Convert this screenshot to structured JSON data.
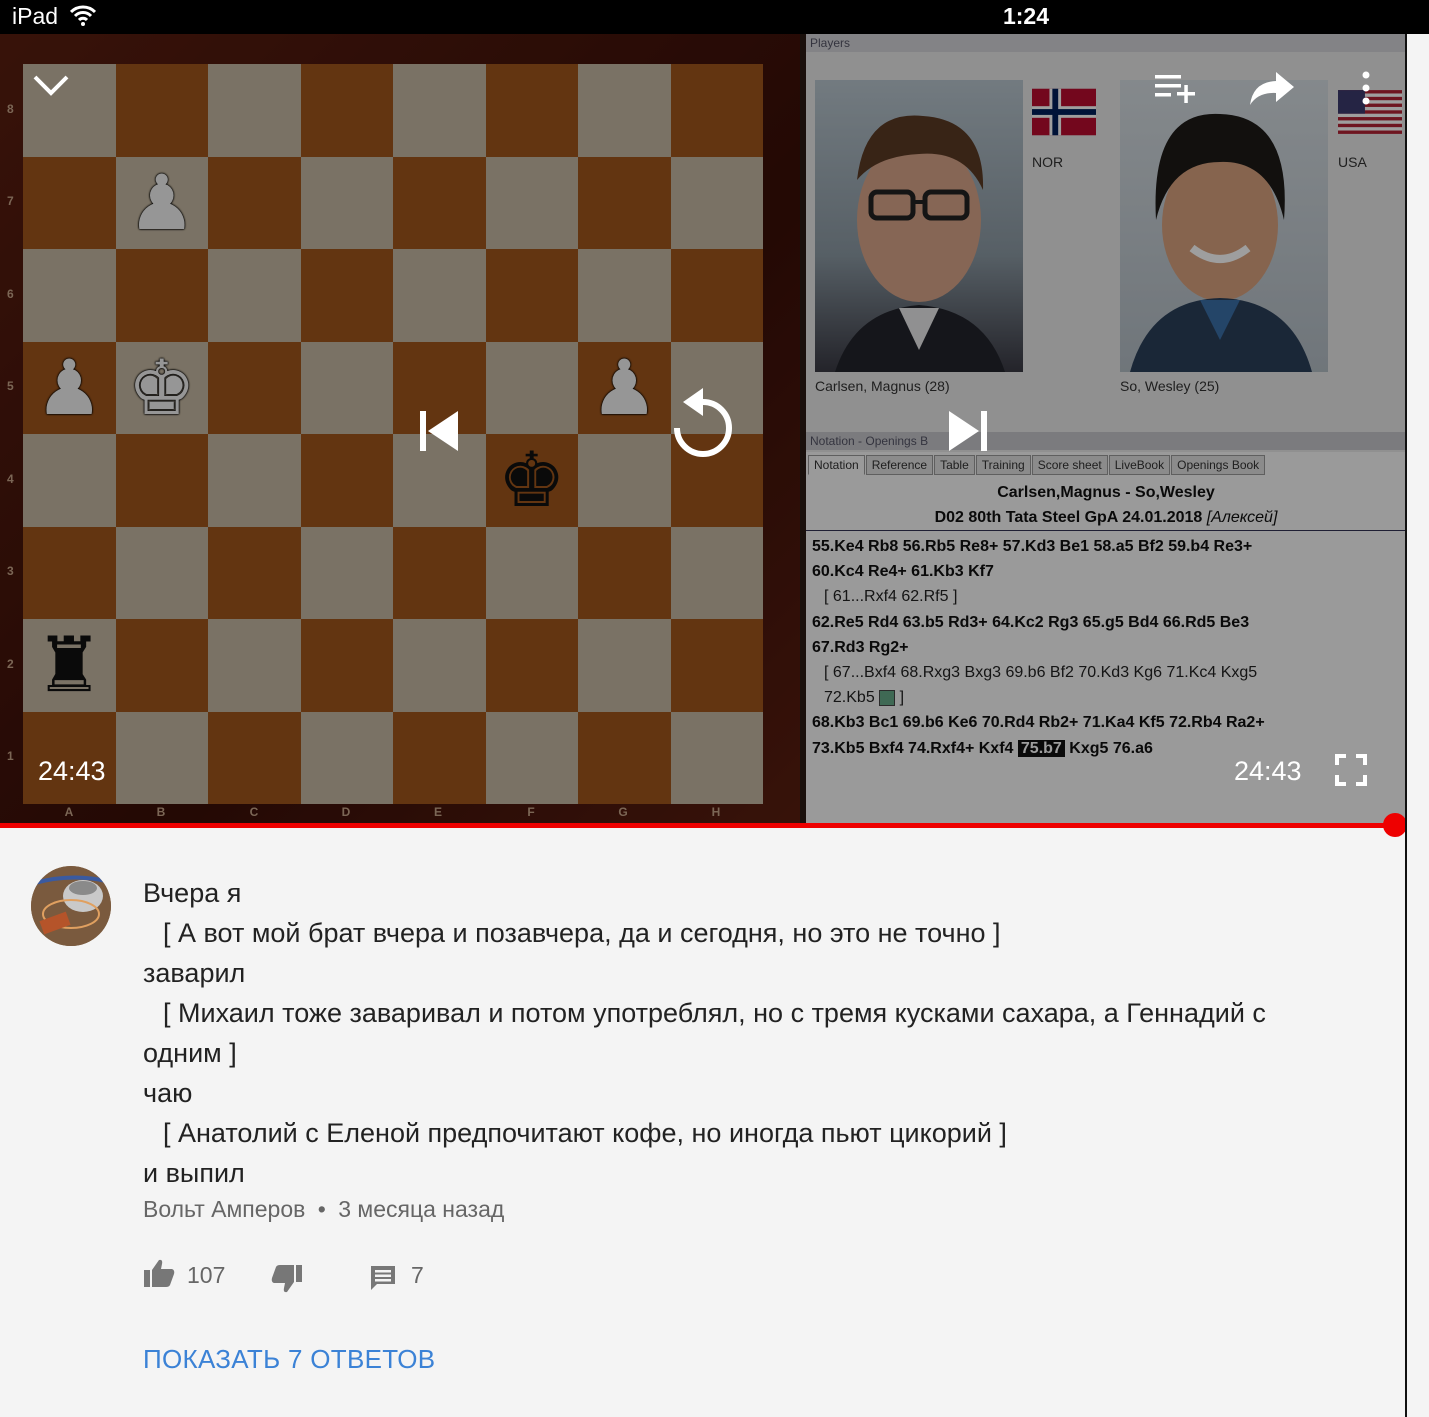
{
  "status_bar": {
    "device": "iPad",
    "time": "1:24"
  },
  "board": {
    "ranks": [
      "8",
      "7",
      "6",
      "5",
      "4",
      "3",
      "2",
      "1"
    ],
    "files": [
      "A",
      "B",
      "C",
      "D",
      "E",
      "F",
      "G",
      "H"
    ]
  },
  "players_panel": {
    "title": "Players",
    "white": {
      "name": "Carlsen, Magnus  (28)",
      "country": "NOR"
    },
    "black": {
      "name": "So, Wesley  (25)",
      "country": "USA"
    }
  },
  "notation_panel": {
    "title": "Notation - Openings B",
    "tabs": [
      "Notation",
      "Reference",
      "Table",
      "Training",
      "Score sheet",
      "LiveBook",
      "Openings Book"
    ],
    "game_players": "Carlsen,Magnus - So,Wesley",
    "game_info": "D02 80th Tata Steel GpA 24.01.2018",
    "game_annotator": "[Алексей]",
    "lines": [
      "55.Ke4  Rb8  56.Rb5  Re8+  57.Kd3  Be1  58.a5  Bf2  59.b4  Re3+",
      "60.Kc4  Re4+  61.Kb3  Kf7",
      "[ 61...Rxf4  62.Rf5 ]",
      "62.Re5  Rd4  63.b5  Rd3+  64.Kc2  Rg3  65.g5  Bd4  66.Rd5  Be3",
      "67.Rd3  Rg2+",
      "[ 67...Bxf4  68.Rxg3  Bxg3  69.b6  Bf2  70.Kd3  Kg6  71.Kc4  Kxg5",
      "72.Kb5",
      "68.Kb3  Bc1  69.b6  Ke6  70.Rd4  Rb2+  71.Ka4  Kf5  72.Rb4  Ra2+",
      "73.Kb5  Bxf4  74.Rxf4+  Kxf4",
      "75.b7",
      "Kxg5  76.a6"
    ]
  },
  "video": {
    "time_left": "24:43",
    "time_right": "24:43",
    "progress": 0.99
  },
  "comment": {
    "lines": [
      "Вчера я",
      "[ А вот мой брат вчера и позавчера, да и сегодня, но это не точно ]",
      "заварил",
      "[ Михаил тоже заваривал и потом употреблял, но с тремя кусками сахара, а Геннадий с",
      "одним ]",
      "чаю",
      "[ Анатолий с Еленой предпочитают кофе, но иногда пьют цикорий ]",
      "и выпил"
    ],
    "author": "Вольт Амперов",
    "separator": "•",
    "age": "3 месяца назад",
    "likes": "107",
    "replies_count": "7",
    "show_replies": "ПОКАЗАТЬ 7 ОТВЕТОВ"
  },
  "icons": [
    "chevron-down-icon",
    "add-to-queue-icon",
    "share-icon",
    "more-icon",
    "previous-icon",
    "replay-icon",
    "next-icon",
    "fullscreen-icon",
    "like-icon",
    "dislike-icon",
    "reply-icon",
    "wifi-icon"
  ]
}
